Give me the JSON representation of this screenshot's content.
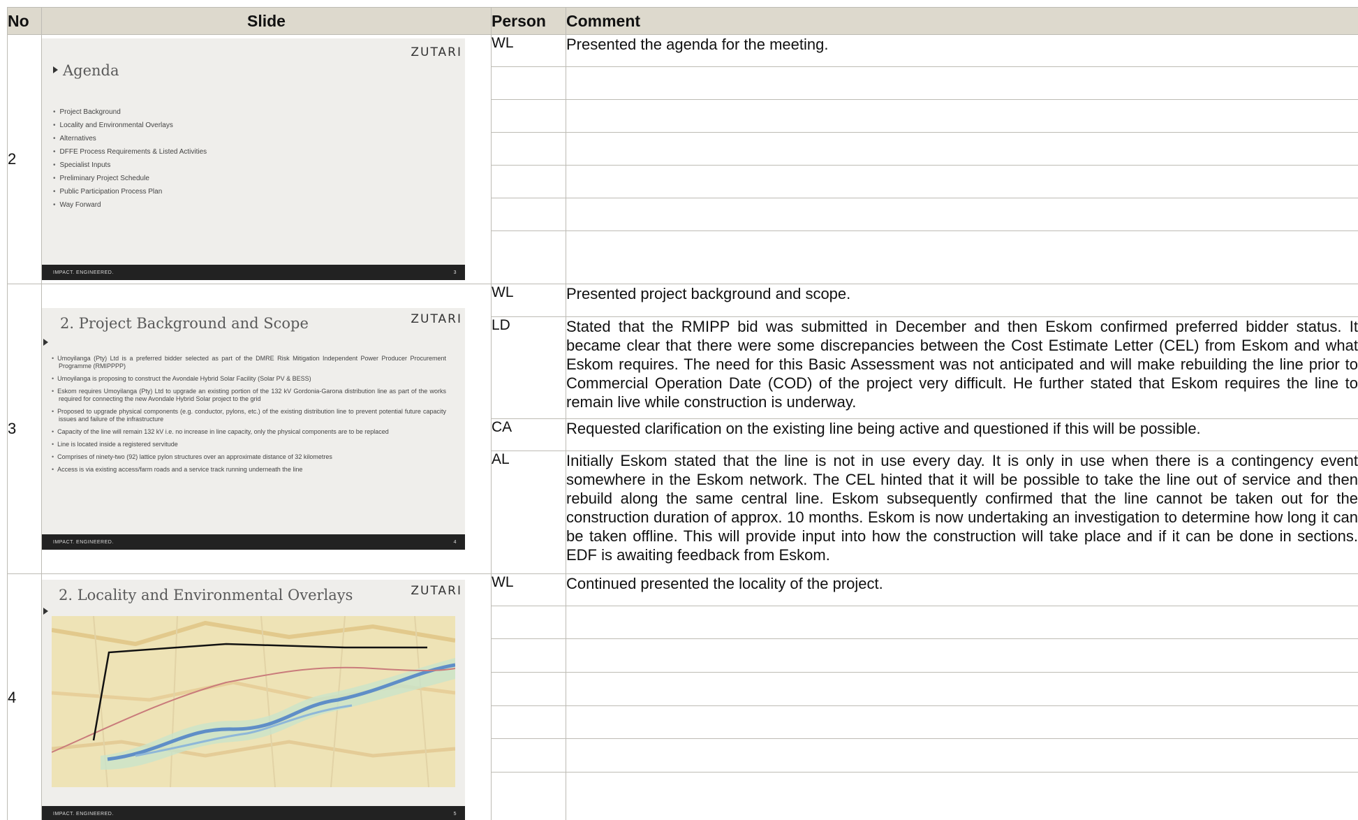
{
  "header": {
    "no": "No",
    "slide": "Slide",
    "person": "Person",
    "comment": "Comment"
  },
  "slide_brand": "ZUTARI",
  "slide_footer": "IMPACT. ENGINEERED.",
  "rows": [
    {
      "no": "2",
      "slide": {
        "title": "Agenda",
        "page": "3",
        "items": [
          "Project Background",
          "Locality and Environmental Overlays",
          "Alternatives",
          "DFFE Process Requirements & Listed Activities",
          "Specialist Inputs",
          "Preliminary Project Schedule",
          "Public Participation Process Plan",
          "Way Forward"
        ]
      },
      "entries": [
        {
          "person": "WL",
          "comment": "Presented the agenda for the meeting."
        }
      ]
    },
    {
      "no": "3",
      "slide": {
        "title": "2. Project Background and Scope",
        "page": "4",
        "items": [
          "Umoyilanga (Pty) Ltd is a preferred bidder selected as part of the DMRE Risk Mitigation Independent Power Producer Procurement Programme (RMIPPPP)",
          "Umoyilanga is proposing to construct the Avondale Hybrid Solar Facility (Solar PV & BESS)",
          "Eskom requires Umoyilanga (Pty) Ltd to upgrade an existing portion of the 132 kV Gordonia-Garona distribution line as part of the works required for connecting the new Avondale Hybrid Solar project to the grid",
          "Proposed to upgrade physical components (e.g. conductor, pylons, etc.) of the existing distribution line to prevent potential future capacity issues and failure of the infrastructure",
          "Capacity of the line will remain 132 kV i.e. no increase in line capacity, only the physical components are to be replaced",
          "Line is located inside a registered servitude",
          "Comprises of ninety-two (92) lattice pylon structures over an approximate distance of 32 kilometres",
          "Access is via existing access/farm roads and a service track running underneath the line"
        ]
      },
      "entries": [
        {
          "person": "WL",
          "comment": "Presented project background and scope."
        },
        {
          "person": "LD",
          "comment": "Stated that the RMIPP bid was submitted in December and then Eskom confirmed preferred bidder status. It became clear that there were some discrepancies between the Cost Estimate Letter (CEL) from Eskom and what Eskom requires. The need for this Basic Assessment was not anticipated and will make rebuilding the line prior to Commercial Operation Date (COD) of the project very difficult. He further stated that Eskom requires the line to remain live while construction is underway."
        },
        {
          "person": "CA",
          "comment": "Requested clarification on the existing line being active and questioned if this will be possible."
        },
        {
          "person": "AL",
          "comment": "Initially Eskom stated that the line is not in use every day. It is only in use when there is a contingency event somewhere in the Eskom network. The CEL hinted that it will be possible to take the line out of service and then rebuild along the same central line. Eskom subsequently confirmed that the line cannot be taken out for the construction duration of approx. 10 months. Eskom is now undertaking an investigation to determine how long it can be taken offline. This will provide input into how the construction will take place and if it can be done in sections. EDF is awaiting feedback from Eskom."
        }
      ]
    },
    {
      "no": "4",
      "slide": {
        "title": "2. Locality and Environmental Overlays",
        "page": "5"
      },
      "entries": [
        {
          "person": "WL",
          "comment": "Continued presented the locality of the project."
        }
      ]
    }
  ]
}
